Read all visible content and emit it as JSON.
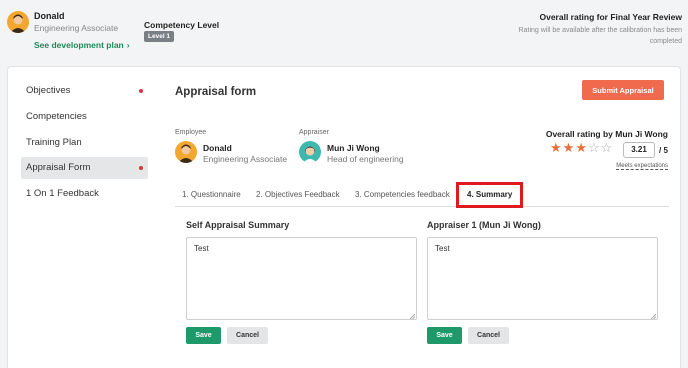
{
  "header": {
    "user_name": "Donald",
    "user_role": "Engineering Associate",
    "dev_plan_link": "See development plan",
    "competency_label": "Competency Level",
    "level_badge": "Level 1",
    "overall_title": "Overall rating for Final Year Review",
    "overall_note": "Rating will be available after the calibration has been completed"
  },
  "sidebar": {
    "items": [
      {
        "label": "Objectives",
        "dot": true,
        "active": false
      },
      {
        "label": "Competencies",
        "dot": false,
        "active": false
      },
      {
        "label": "Training Plan",
        "dot": false,
        "active": false
      },
      {
        "label": "Appraisal Form",
        "dot": true,
        "active": true
      },
      {
        "label": "1 On 1 Feedback",
        "dot": false,
        "active": false
      }
    ]
  },
  "form": {
    "title": "Appraisal form",
    "submit_label": "Submit Appraisal",
    "employee_label": "Employee",
    "employee_name": "Donald",
    "employee_role": "Engineering Associate",
    "appraiser_label": "Appraiser",
    "appraiser_name": "Mun Ji Wong",
    "appraiser_role": "Head of engineering",
    "rating_title": "Overall rating by Mun Ji Wong",
    "rating_value": "3.21",
    "rating_max": "/ 5",
    "stars_filled": 3,
    "stars_total": 5,
    "meets_label": "Meets expectations"
  },
  "tabs": [
    {
      "label": "1. Questionnaire",
      "active": false
    },
    {
      "label": "2. Objectives Feedback",
      "active": false
    },
    {
      "label": "3. Competencies feedback",
      "active": false
    },
    {
      "label": "4. Summary",
      "active": true
    }
  ],
  "summary": {
    "self": {
      "title": "Self Appraisal Summary",
      "value": "Test",
      "save": "Save",
      "cancel": "Cancel"
    },
    "appraiser": {
      "title": "Appraiser 1 (Mun Ji Wong)",
      "value": "Test",
      "save": "Save",
      "cancel": "Cancel"
    }
  },
  "colors": {
    "accent_green": "#1e9a6a",
    "submit_orange": "#f06a4e",
    "star_orange": "#e8703a",
    "dot_red": "#d9363e",
    "highlight_red": "#e0191f"
  }
}
